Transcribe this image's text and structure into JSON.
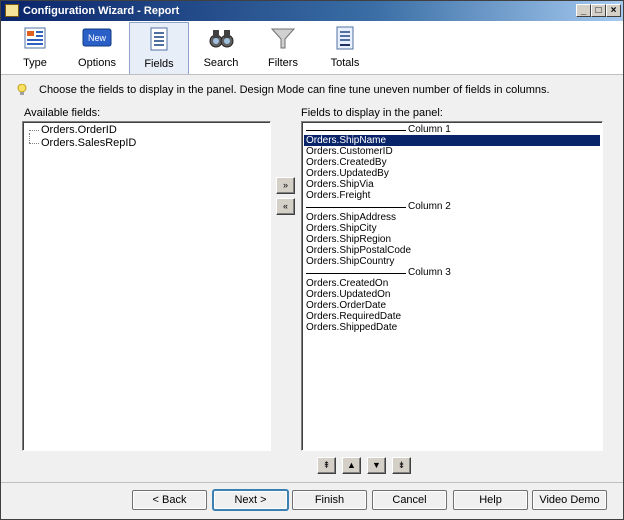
{
  "window": {
    "title": "Configuration Wizard - Report"
  },
  "toolbar": {
    "items": [
      {
        "label": "Type",
        "icon": "type-icon"
      },
      {
        "label": "Options",
        "icon": "new-badge-icon",
        "badge": "New"
      },
      {
        "label": "Fields",
        "icon": "fields-list-icon",
        "active": true
      },
      {
        "label": "Search",
        "icon": "binoculars-icon"
      },
      {
        "label": "Filters",
        "icon": "funnel-icon"
      },
      {
        "label": "Totals",
        "icon": "totals-icon"
      }
    ]
  },
  "info": {
    "message": "Choose the fields to display in the panel. Design Mode can fine tune uneven number of fields in columns."
  },
  "available": {
    "label": "Available fields:",
    "items": [
      "Orders.OrderID",
      "Orders.SalesRepID"
    ]
  },
  "display": {
    "label": "Fields to display in the panel:",
    "rows": [
      {
        "type": "sep",
        "text": "Column 1"
      },
      {
        "type": "field",
        "text": "Orders.ShipName",
        "selected": true
      },
      {
        "type": "field",
        "text": "Orders.CustomerID"
      },
      {
        "type": "field",
        "text": "Orders.CreatedBy"
      },
      {
        "type": "field",
        "text": "Orders.UpdatedBy"
      },
      {
        "type": "field",
        "text": "Orders.ShipVia"
      },
      {
        "type": "field",
        "text": "Orders.Freight"
      },
      {
        "type": "sep",
        "text": "Column 2"
      },
      {
        "type": "field",
        "text": "Orders.ShipAddress"
      },
      {
        "type": "field",
        "text": "Orders.ShipCity"
      },
      {
        "type": "field",
        "text": "Orders.ShipRegion"
      },
      {
        "type": "field",
        "text": "Orders.ShipPostalCode"
      },
      {
        "type": "field",
        "text": "Orders.ShipCountry"
      },
      {
        "type": "sep",
        "text": "Column 3"
      },
      {
        "type": "field",
        "text": "Orders.CreatedOn"
      },
      {
        "type": "field",
        "text": "Orders.UpdatedOn"
      },
      {
        "type": "field",
        "text": "Orders.OrderDate"
      },
      {
        "type": "field",
        "text": "Orders.RequiredDate"
      },
      {
        "type": "field",
        "text": "Orders.ShippedDate"
      }
    ]
  },
  "transfer": {
    "add": "»",
    "remove": "«"
  },
  "order": {
    "top": "⇞",
    "up": "▲",
    "down": "▼",
    "bottom": "⇟"
  },
  "buttons": {
    "back": "< Back",
    "next": "Next >",
    "finish": "Finish",
    "cancel": "Cancel",
    "help": "Help",
    "video": "Video Demo"
  },
  "colors": {
    "selection": "#0a246a",
    "title_start": "#0a246a"
  }
}
